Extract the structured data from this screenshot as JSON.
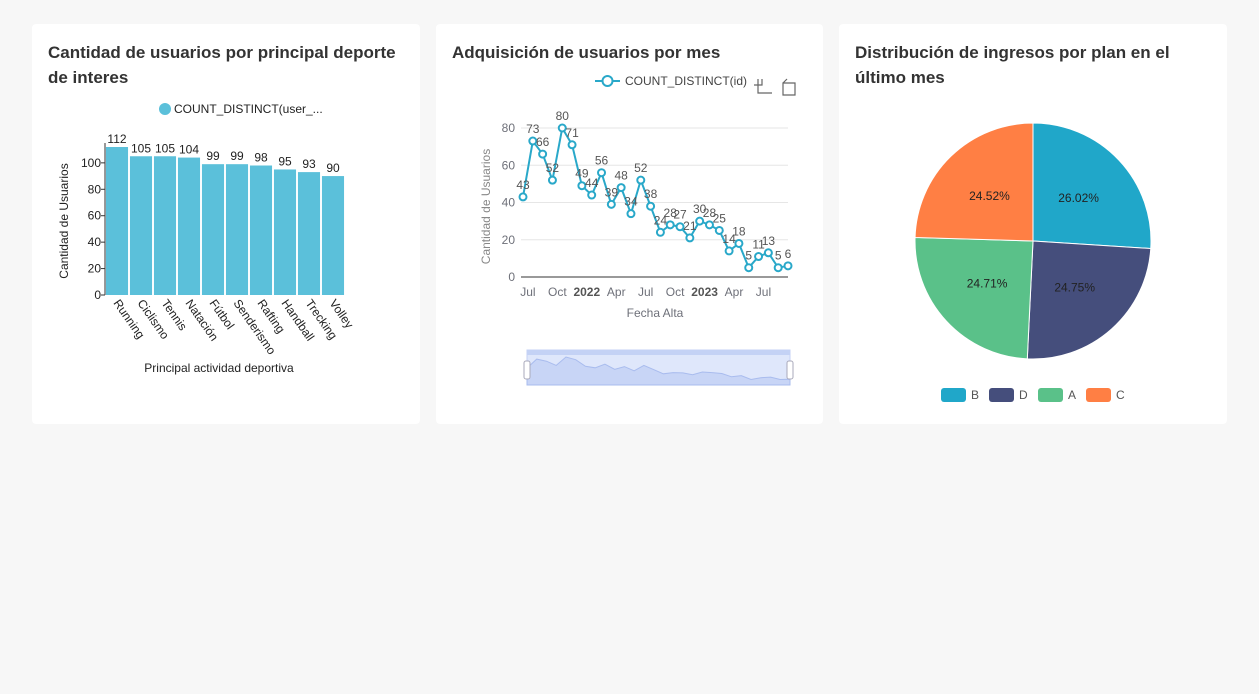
{
  "charts": [
    {
      "title": "Cantidad de usuarios por principal deporte de interes",
      "chart_data": {
        "type": "bar",
        "legend": "COUNT_DISTINCT(user_...",
        "categories": [
          "Running",
          "Ciclismo",
          "Tennis",
          "Natación",
          "Fútbol",
          "Senderismo",
          "Rafting",
          "Handball",
          "Trecking",
          "Volley"
        ],
        "values": [
          112,
          105,
          105,
          104,
          99,
          99,
          98,
          95,
          93,
          90
        ],
        "xlabel": "Principal actividad deportiva",
        "ylabel": "Cantidad de Usuarios",
        "ylim": [
          0,
          112
        ],
        "yticks": [
          0,
          20,
          40,
          60,
          80,
          100
        ],
        "color": "#5bc0da"
      }
    },
    {
      "title": "Adquisición de usuarios por mes",
      "chart_data": {
        "type": "line",
        "legend": "COUNT_DISTINCT(id)",
        "values": [
          43,
          73,
          66,
          52,
          80,
          71,
          49,
          44,
          56,
          39,
          48,
          34,
          52,
          38,
          24,
          28,
          27,
          21,
          30,
          28,
          25,
          14,
          18,
          5,
          11,
          13,
          5,
          6
        ],
        "xticks": [
          "Jul",
          "Oct",
          "2022",
          "Apr",
          "Jul",
          "Oct",
          "2023",
          "Apr",
          "Jul"
        ],
        "xlabel": "Fecha Alta",
        "ylabel": "Cantidad de Usuarios",
        "ylim": [
          0,
          80
        ],
        "yticks": [
          0,
          20,
          40,
          60,
          80
        ],
        "color": "#29a8c9"
      }
    },
    {
      "title": "Distribución de ingresos por plan en el último mes",
      "chart_data": {
        "type": "pie",
        "slices": [
          {
            "name": "B",
            "value": 26.02,
            "label": "26.02%",
            "color": "#20a7c9"
          },
          {
            "name": "D",
            "value": 24.75,
            "label": "24.75%",
            "color": "#454e7c"
          },
          {
            "name": "A",
            "value": 24.71,
            "label": "24.71%",
            "color": "#5ac189"
          },
          {
            "name": "C",
            "value": 24.52,
            "label": "24.52%",
            "color": "#ff7f44"
          }
        ]
      }
    }
  ]
}
